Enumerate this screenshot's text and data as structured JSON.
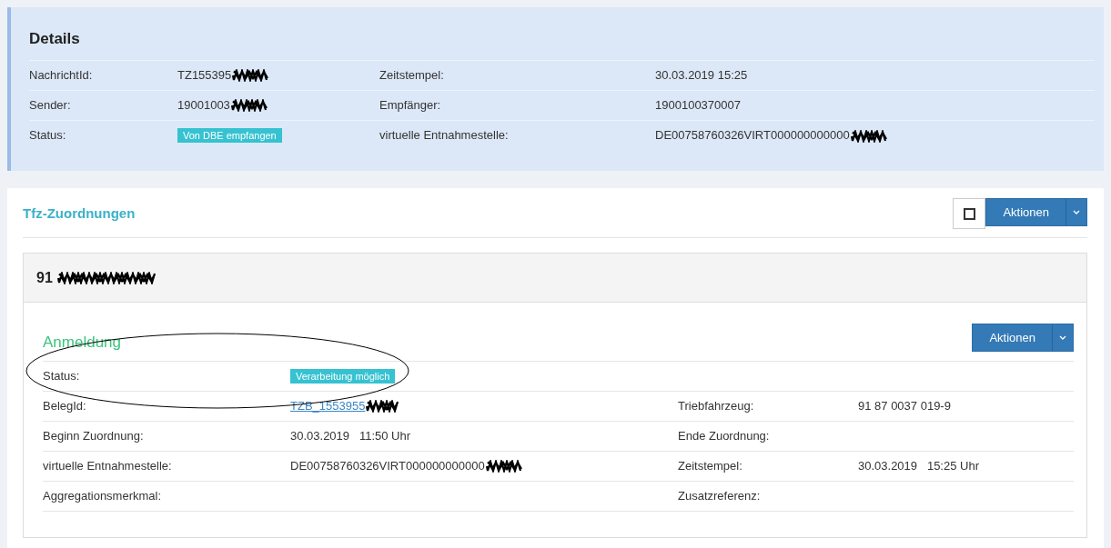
{
  "details": {
    "title": "Details",
    "rows": [
      {
        "cells": [
          {
            "label": "NachrichtId:",
            "value": "TZ155395",
            "kind": "text",
            "redacted": true
          },
          {
            "label": "Zeitstempel:",
            "value": "30.03.2019 15:25",
            "kind": "text"
          }
        ]
      },
      {
        "cells": [
          {
            "label": "Sender:",
            "value": "19001003",
            "kind": "text",
            "redacted": true
          },
          {
            "label": "Empfänger:",
            "value": "1900100370007",
            "kind": "text"
          }
        ]
      },
      {
        "cells": [
          {
            "label": "Status:",
            "value": "Von DBE empfangen",
            "kind": "badge"
          },
          {
            "label": "virtuelle Entnahmestelle:",
            "value": "DE00758760326VIRT000000000000",
            "kind": "text",
            "redacted": true
          }
        ]
      }
    ]
  },
  "assignments": {
    "title": "Tfz-Zuordnungen",
    "select_all": {
      "checked": false
    },
    "actions_button": "Aktionen",
    "card": {
      "title": "91",
      "redacted": true,
      "section_title": "Anmeldung",
      "actions_button": "Aktionen",
      "rows": [
        {
          "cells": [
            {
              "label": "Status:",
              "value": "Verarbeitung möglich",
              "kind": "badge"
            }
          ]
        },
        {
          "cells": [
            {
              "label": "BelegId:",
              "value": "TZB_1553955",
              "kind": "link",
              "redacted": true
            },
            {
              "label": "Triebfahrzeug:",
              "value": "91 87 0037 019-9",
              "kind": "text"
            }
          ]
        },
        {
          "cells": [
            {
              "label": "Beginn Zuordnung:",
              "value": "30.03.2019   11:50 Uhr",
              "kind": "text"
            },
            {
              "label": "Ende Zuordnung:"
            }
          ]
        },
        {
          "cells": [
            {
              "label": "virtuelle Entnahmestelle:",
              "value": "DE00758760326VIRT000000000000",
              "kind": "text",
              "redacted": true
            },
            {
              "label": "Zeitstempel:",
              "value": "30.03.2019   15:25 Uhr",
              "kind": "text"
            }
          ]
        },
        {
          "cells": [
            {
              "label": "Aggregationsmerkmal:"
            },
            {
              "label": "Zusatzreferenz:"
            }
          ]
        }
      ]
    }
  }
}
